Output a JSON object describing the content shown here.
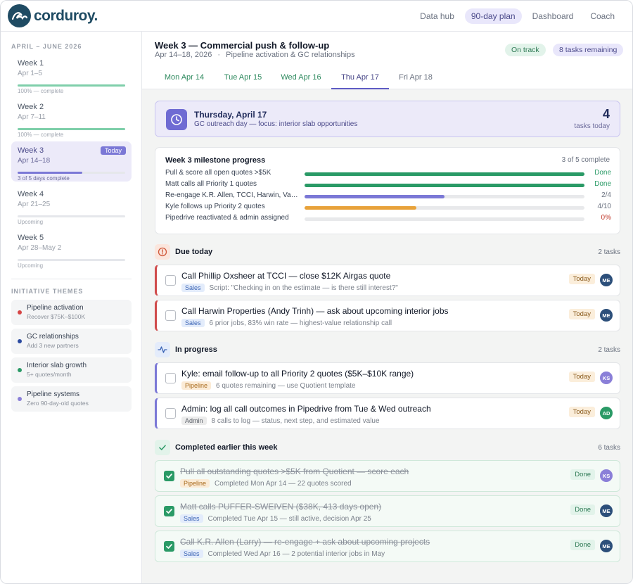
{
  "brand": {
    "name": "corduroy."
  },
  "nav": {
    "items": [
      {
        "label": "Data hub"
      },
      {
        "label": "90-day plan"
      },
      {
        "label": "Dashboard"
      },
      {
        "label": "Coach"
      }
    ]
  },
  "sidebar": {
    "period": "APRIL – JUNE 2026",
    "weeks": [
      {
        "label": "Week 1",
        "dates": "Apr 1–5",
        "status": "100% — complete",
        "progress": 1.0
      },
      {
        "label": "Week 2",
        "dates": "Apr 7–11",
        "status": "100% — complete",
        "progress": 1.0
      },
      {
        "label": "Week 3",
        "dates": "Apr 14–18",
        "status": "3 of 5 days complete",
        "progress": 0.6,
        "badge": "Today"
      },
      {
        "label": "Week 4",
        "dates": "Apr 21–25",
        "status": "Upcoming",
        "progress": 0
      },
      {
        "label": "Week 5",
        "dates": "Apr 28–May 2",
        "status": "Upcoming",
        "progress": 0
      }
    ],
    "themes_heading": "INITIATIVE THEMES",
    "themes": [
      {
        "name": "Pipeline activation",
        "sub": "Recover $75K–$100K",
        "color": "#d64545"
      },
      {
        "name": "GC relationships",
        "sub": "Add 3 new partners",
        "color": "#2b4aa0"
      },
      {
        "name": "Interior slab growth",
        "sub": "5+ quotes/month",
        "color": "#2a9a66"
      },
      {
        "name": "Pipeline systems",
        "sub": "Zero 90-day-old quotes",
        "color": "#8a7fd8"
      }
    ]
  },
  "header": {
    "title": "Week 3 — Commercial push & follow-up",
    "dates": "Apr 14–18, 2026",
    "separator": "·",
    "subtitle": "Pipeline activation & GC relationships",
    "status_pill": "On track",
    "remaining_pill": "8 tasks remaining"
  },
  "tabs": [
    {
      "label": "Mon Apr 14"
    },
    {
      "label": "Tue Apr 15"
    },
    {
      "label": "Wed Apr 16"
    },
    {
      "label": "Thu Apr 17"
    },
    {
      "label": "Fri Apr 18"
    }
  ],
  "day": {
    "title": "Thursday, April 17",
    "subtitle": "GC outreach day — focus: interior slab opportunities",
    "count": "4",
    "count_label": "tasks today"
  },
  "milestones": {
    "title": "Week 3 milestone progress",
    "summary": "3 of 5 complete",
    "items": [
      {
        "label": "Pull & score all open quotes >$5K",
        "value": "Done",
        "progress": 1.0,
        "color": "#2a9a66",
        "value_color": "#2a9a66"
      },
      {
        "label": "Matt calls all Priority 1 quotes",
        "value": "Done",
        "progress": 1.0,
        "color": "#2a9a66",
        "value_color": "#2a9a66"
      },
      {
        "label": "Re-engage K.R. Allen, TCCI, Harwin, Va…",
        "value": "2/4",
        "progress": 0.5,
        "color": "#7b78d6",
        "value_color": "#6b7280"
      },
      {
        "label": "Kyle follows up Priority 2 quotes",
        "value": "4/10",
        "progress": 0.4,
        "color": "#e8a23a",
        "value_color": "#6b7280"
      },
      {
        "label": "Pipedrive reactivated & admin assigned",
        "value": "0%",
        "progress": 0,
        "color": "#e8a23a",
        "value_color": "#c0392b"
      }
    ]
  },
  "sections": {
    "due": {
      "title": "Due today",
      "count": "2 tasks"
    },
    "progress": {
      "title": "In progress",
      "count": "2 tasks"
    },
    "completed": {
      "title": "Completed earlier this week",
      "count": "6 tasks"
    }
  },
  "tasks": {
    "due": [
      {
        "title": "Call Phillip Oxsheer at TCCI — close $12K Airgas quote",
        "tag": "Sales",
        "meta": "Script: \"Checking in on the estimate — is there still interest?\"",
        "status": "Today",
        "avatar": "ME",
        "avatar_color": "#2c4f7a"
      },
      {
        "title": "Call Harwin Properties (Andy Trinh) — ask about upcoming interior jobs",
        "tag": "Sales",
        "meta": "6 prior jobs, 83% win rate — highest-value relationship call",
        "status": "Today",
        "avatar": "ME",
        "avatar_color": "#2c4f7a"
      }
    ],
    "progress": [
      {
        "title": "Kyle: email follow-up to all Priority 2 quotes ($5K–$10K range)",
        "tag": "Pipeline",
        "meta": "6 quotes remaining — use Quotient template",
        "status": "Today",
        "avatar": "KS",
        "avatar_color": "#8a7fd8"
      },
      {
        "title": "Admin: log all call outcomes in Pipedrive from Tue & Wed outreach",
        "tag": "Admin",
        "meta": "8 calls to log — status, next step, and estimated value",
        "status": "Today",
        "avatar": "AD",
        "avatar_color": "#2a9a66"
      }
    ],
    "completed": [
      {
        "title": "Pull all outstanding quotes >$5K from Quotient — score each",
        "tag": "Pipeline",
        "meta": "Completed Mon Apr 14 — 22 quotes scored",
        "status": "Done",
        "avatar": "KS",
        "avatar_color": "#8a7fd8"
      },
      {
        "title": "Matt calls PUFFER-SWEIVEN ($38K, 413 days open)",
        "tag": "Sales",
        "meta": "Completed Tue Apr 15 — still active, decision Apr 25",
        "status": "Done",
        "avatar": "ME",
        "avatar_color": "#2c4f7a"
      },
      {
        "title": "Call K.R. Allen (Larry) — re-engage + ask about upcoming projects",
        "tag": "Sales",
        "meta": "Completed Wed Apr 16 — 2 potential interior jobs in May",
        "status": "Done",
        "avatar": "ME",
        "avatar_color": "#2c4f7a"
      }
    ]
  },
  "colors": {
    "accent": "#5e5bc4",
    "brand": "#1f4b63",
    "complete": "#7fcfaa",
    "current_week": "#7b78d6"
  }
}
